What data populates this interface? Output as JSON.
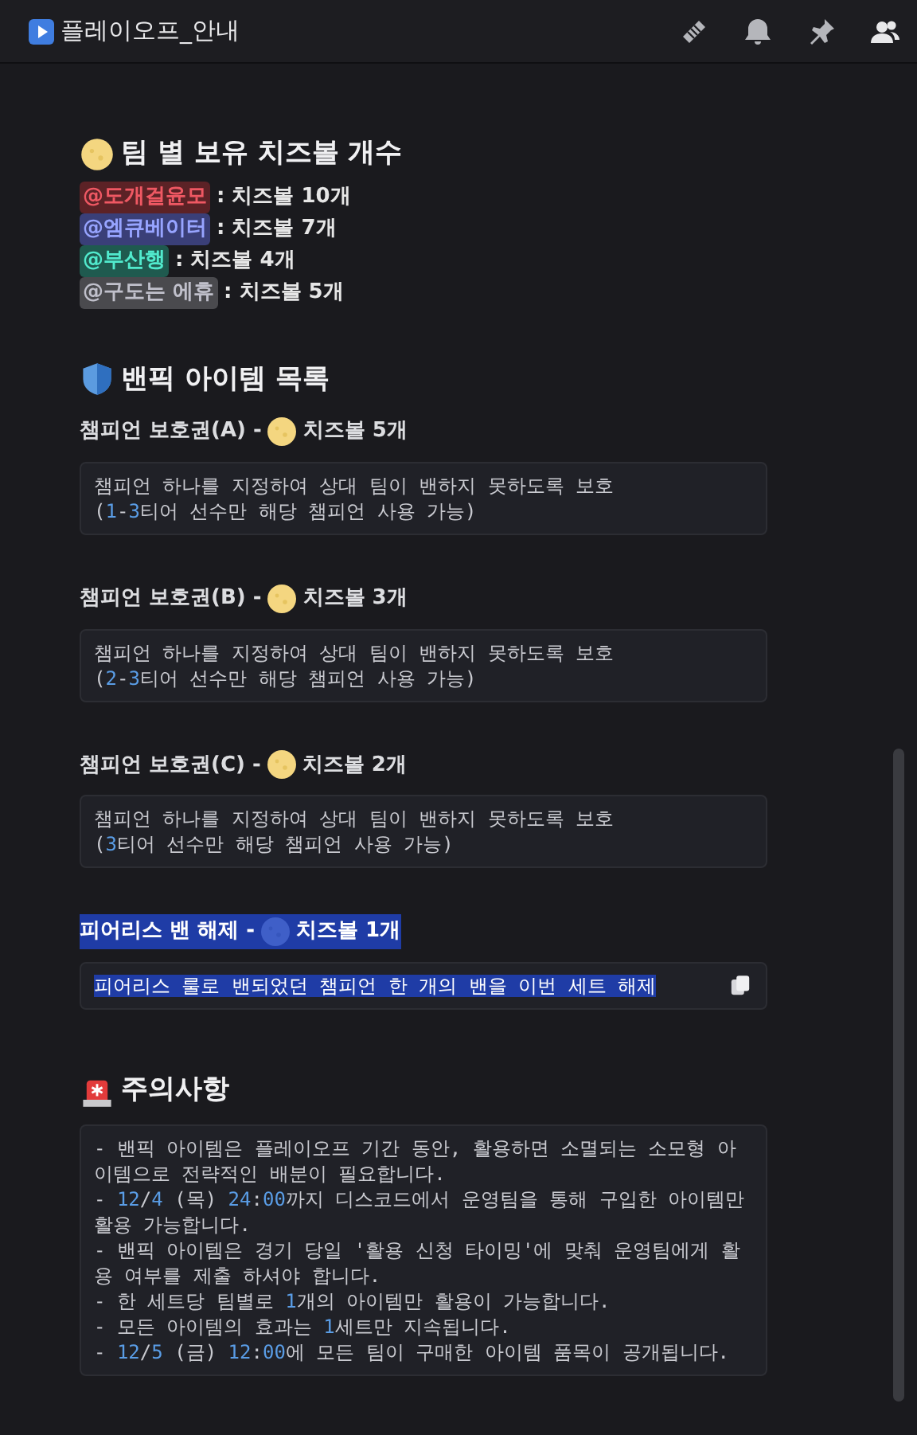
{
  "channel": {
    "title": "플레이오프_안내"
  },
  "cheese_counts": {
    "heading": "팀 별 보유 치즈볼 개수",
    "rows": [
      {
        "mention": "@도개걸윤모",
        "color": "#5c2226",
        "count": ": 치즈볼 10개"
      },
      {
        "mention": "@엠큐베이터",
        "color": "#3a3f78",
        "count": ": 치즈볼 7개"
      },
      {
        "mention": "@부산행",
        "color": "#1f5a4f",
        "count": ": 치즈볼 4개"
      },
      {
        "mention": "@구도는 에휴",
        "color": "#4a4a4e",
        "count": ": 치즈볼 5개"
      }
    ]
  },
  "ban_items": {
    "heading": "밴픽 아이템 목록",
    "items": [
      {
        "name": "챔피언 보호권(A) -",
        "cost": "치즈볼 5개",
        "selected": false,
        "lines": [
          [
            {
              "text": "챔피언 하나를 지정하여 상대 팀이 밴하지 못하도록 보호",
              "highlight": false
            }
          ],
          [
            {
              "text": "(",
              "highlight": false
            },
            {
              "text": "1",
              "highlight": true
            },
            {
              "text": "-",
              "highlight": false
            },
            {
              "text": "3",
              "highlight": true
            },
            {
              "text": "티어 선수만 해당 챔피언 사용 가능)",
              "highlight": false
            }
          ]
        ]
      },
      {
        "name": "챔피언 보호권(B) -",
        "cost": "치즈볼 3개",
        "selected": false,
        "lines": [
          [
            {
              "text": "챔피언 하나를 지정하여 상대 팀이 밴하지 못하도록 보호",
              "highlight": false
            }
          ],
          [
            {
              "text": "(",
              "highlight": false
            },
            {
              "text": "2",
              "highlight": true
            },
            {
              "text": "-",
              "highlight": false
            },
            {
              "text": "3",
              "highlight": true
            },
            {
              "text": "티어 선수만 해당 챔피언 사용 가능)",
              "highlight": false
            }
          ]
        ]
      },
      {
        "name": "챔피언 보호권(C) -",
        "cost": "치즈볼 2개",
        "selected": false,
        "lines": [
          [
            {
              "text": "챔피언 하나를 지정하여 상대 팀이 밴하지 못하도록 보호",
              "highlight": false
            }
          ],
          [
            {
              "text": "(",
              "highlight": false
            },
            {
              "text": "3",
              "highlight": true
            },
            {
              "text": "티어 선수만 해당 챔피언 사용 가능)",
              "highlight": false
            }
          ]
        ]
      },
      {
        "name": "피어리스 밴 해제 -",
        "cost": "치즈볼 1개",
        "selected": true,
        "lines": [
          [
            {
              "text": "피어리스 룰로 밴되었던 챔피언 한 개의 밴을 이번 세트 해제",
              "highlight": false
            }
          ]
        ]
      }
    ]
  },
  "notes": {
    "heading": "주의사항",
    "lines": [
      [
        {
          "text": "- 밴픽 아이템은 플레이오프 기간 동안, 활용하면 소멸되는 소모형 아이템으로 전략적인 배분이 필요합니다.",
          "highlight": false
        }
      ],
      [
        {
          "text": "- ",
          "highlight": false
        },
        {
          "text": "12",
          "highlight": true
        },
        {
          "text": "/",
          "highlight": false
        },
        {
          "text": "4",
          "highlight": true
        },
        {
          "text": " (목) ",
          "highlight": false
        },
        {
          "text": "24",
          "highlight": true
        },
        {
          "text": ":",
          "highlight": false
        },
        {
          "text": "00",
          "highlight": true
        },
        {
          "text": "까지 디스코드에서 운영팀을 통해 구입한 아이템만 활용 가능합니다.",
          "highlight": false
        }
      ],
      [
        {
          "text": "- 밴픽 아이템은 경기 당일 '활용 신청 타이밍'에 맞춰 운영팀에게 활용 여부를 제출 하셔야 합니다.",
          "highlight": false
        }
      ],
      [
        {
          "text": "- 한 세트당 팀별로 ",
          "highlight": false
        },
        {
          "text": "1",
          "highlight": true
        },
        {
          "text": "개의 아이템만 활용이 가능합니다.",
          "highlight": false
        }
      ],
      [
        {
          "text": "- 모든 아이템의 효과는 ",
          "highlight": false
        },
        {
          "text": "1",
          "highlight": true
        },
        {
          "text": "세트만 지속됩니다.",
          "highlight": false
        }
      ],
      [
        {
          "text": "- ",
          "highlight": false
        },
        {
          "text": "12",
          "highlight": true
        },
        {
          "text": "/",
          "highlight": false
        },
        {
          "text": "5",
          "highlight": true
        },
        {
          "text": " (금) ",
          "highlight": false
        },
        {
          "text": "12",
          "highlight": true
        },
        {
          "text": ":",
          "highlight": false
        },
        {
          "text": "00",
          "highlight": true
        },
        {
          "text": "에 모든 팀이 구매한 아이템 품목이 공개됩니다.",
          "highlight": false
        }
      ]
    ]
  }
}
